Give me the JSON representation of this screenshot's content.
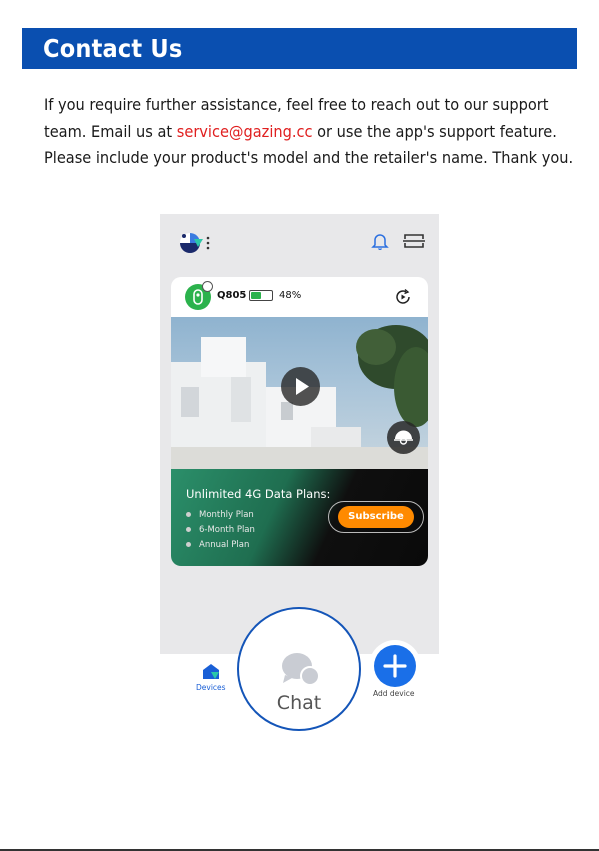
{
  "header": {
    "title": "Contact Us"
  },
  "body": {
    "text_before": "If you require further assistance, feel free to reach out to our support team. Email us at ",
    "email": "service@gazing.cc",
    "text_after": " or use the app's support feature. Please include your product's model and the retailer's name. Thank you."
  },
  "app": {
    "device": {
      "name": "Q805",
      "battery_percent": 48,
      "battery_label": "48%"
    },
    "promo": {
      "title": "Unlimited 4G Data Plans:",
      "plans": [
        "Monthly Plan",
        "6-Month Plan",
        "Annual Plan"
      ],
      "subscribe_label": "Subscribe"
    },
    "tabs": {
      "devices_label": "Devices",
      "chat_label": "Chat",
      "add_label": "Add device"
    }
  },
  "colors": {
    "header_bg": "#0a4fb0",
    "email": "#e02020",
    "accent": "#1a6fe8",
    "subscribe": "#ff8a00",
    "battery": "#2bb24c"
  }
}
